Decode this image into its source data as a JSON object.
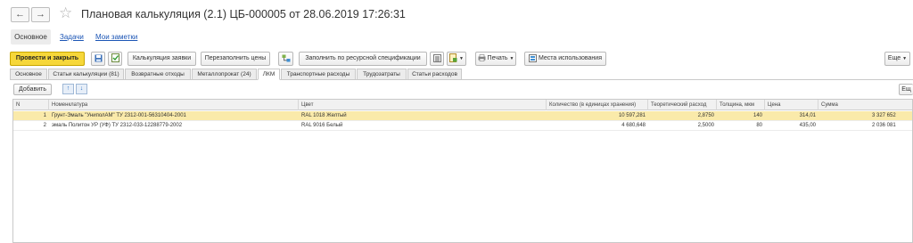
{
  "window": {
    "title": "Плановая калькуляция (2.1) ЦБ-000005 от 28.06.2019 17:26:31",
    "back_icon": "←",
    "forward_icon": "→",
    "star_icon": "☆"
  },
  "top_tabs": [
    "Основное",
    "Задачи",
    "Мои заметки"
  ],
  "toolbar": {
    "post_close": "Провести и закрыть",
    "calc_request": "Калькуляция заявки",
    "refill_prices": "Перезаполнить цены",
    "fill_by_spec": "Заполнить по ресурсной спецификации",
    "print": "Печать",
    "usage_places": "Места использования",
    "more": "Еще"
  },
  "sub_tabs": [
    "Основное",
    "Статьи калькуляции (81)",
    "Возвратные отходы",
    "Металлопрокат (24)",
    "ЛКМ",
    "Транспортные расходы",
    "Трудозатраты",
    "Статьи расходов"
  ],
  "table_toolbar": {
    "add": "Добавить",
    "up_icon": "↑",
    "down_icon": "↓",
    "more": "Ещ"
  },
  "table": {
    "columns": [
      "N",
      "Номенклатура",
      "Цвет",
      "Количество (в единицах хранения)",
      "Теоретический расход",
      "Толщина, мкм",
      "Цена",
      "Сумма"
    ],
    "rows": [
      {
        "n": "1",
        "item": "Грунт-Эмаль \"УниполАМ\" ТУ 2312-001-56310404-2001",
        "color": "RAL 1018 Желтый",
        "qty": "10 597,281",
        "rate": "2,8750",
        "thickness": "140",
        "price": "314,01",
        "sum": "3 327 652"
      },
      {
        "n": "2",
        "item": "эмаль Политон УР (УФ) ТУ 2312-033-12288779-2002",
        "color": "RAL 9016 Белый",
        "qty": "4 680,648",
        "rate": "2,5000",
        "thickness": "80",
        "price": "435,00",
        "sum": "2 036 081"
      }
    ]
  }
}
